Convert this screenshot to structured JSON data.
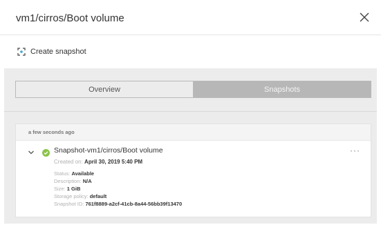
{
  "dialog": {
    "title": "vm1/cirros/Boot volume"
  },
  "toolbar": {
    "create_snapshot_label": "Create snapshot"
  },
  "tabs": [
    {
      "label": "Overview",
      "active": false
    },
    {
      "label": "Snapshots",
      "active": true
    }
  ],
  "group": {
    "time_label": "a few seconds ago"
  },
  "snapshot": {
    "name": "Snapshot-vm1/cirros/Boot volume",
    "created_label": "Created on:",
    "created_value": "April 30, 2019 5:40 PM",
    "status_label": "Status:",
    "status_value": "Available",
    "description_label": "Description:",
    "description_value": "N/A",
    "size_label": "Size:",
    "size_value": "1 GiB",
    "policy_label": "Storage policy:",
    "policy_value": "default",
    "id_label": "Snapshot ID:",
    "id_value": "761f8889-a2cf-41cb-8a44-56bb39f13470",
    "more_label": "···"
  },
  "colors": {
    "status_ok": "#8bc34a",
    "active_tab": "#b7b7b7",
    "panel_bg": "#ececec"
  },
  "icons": [
    "close-icon",
    "snapshot-icon",
    "chevron-down-icon",
    "check-circle-icon",
    "more-icon"
  ]
}
